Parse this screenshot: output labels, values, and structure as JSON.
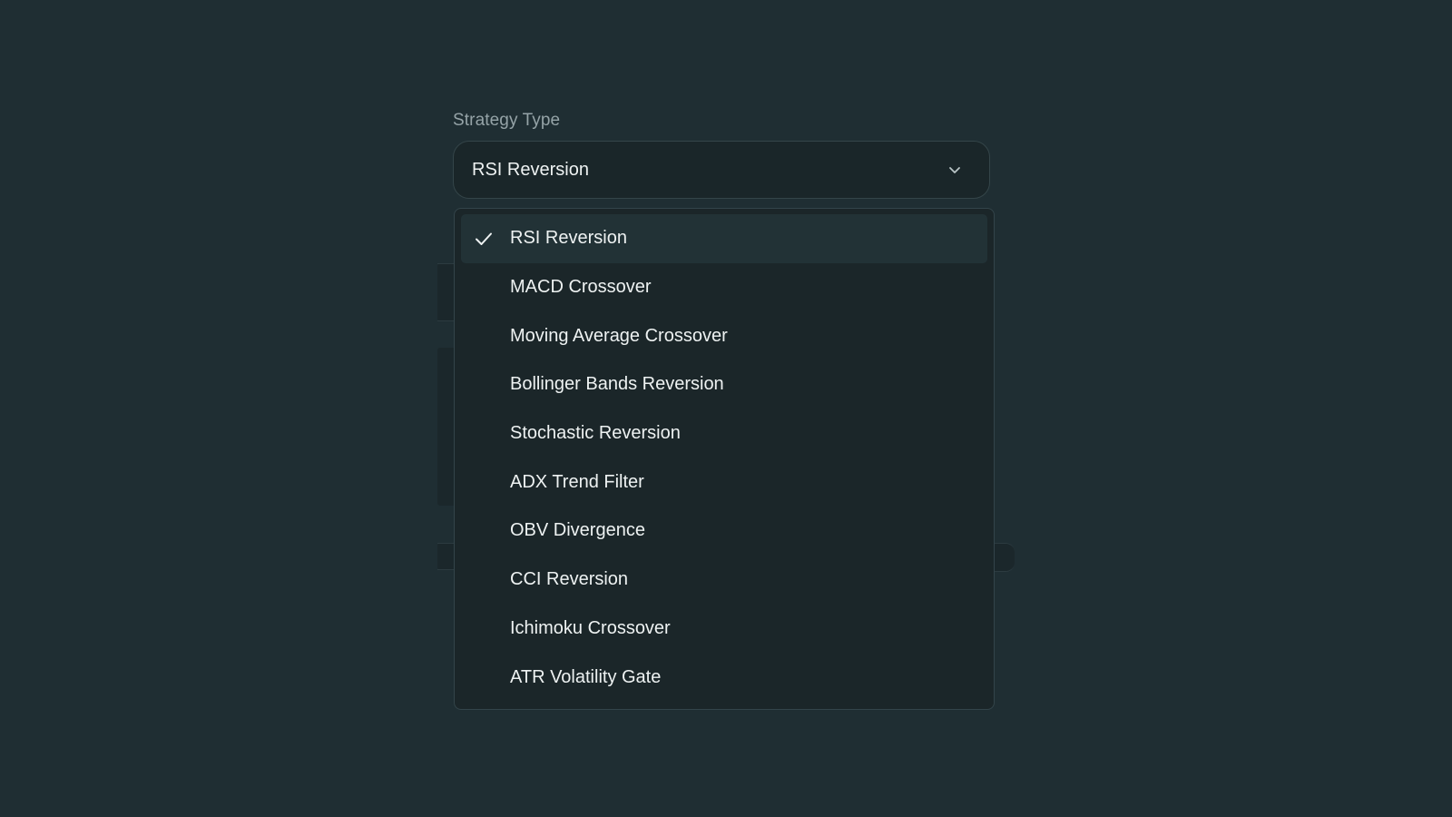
{
  "field": {
    "label": "Strategy Type",
    "selected_value": "RSI Reversion"
  },
  "dropdown": {
    "selected_index": 0,
    "options": [
      {
        "label": "RSI Reversion",
        "selected": true
      },
      {
        "label": "MACD Crossover",
        "selected": false
      },
      {
        "label": "Moving Average Crossover",
        "selected": false
      },
      {
        "label": "Bollinger Bands Reversion",
        "selected": false
      },
      {
        "label": "Stochastic Reversion",
        "selected": false
      },
      {
        "label": "ADX Trend Filter",
        "selected": false
      },
      {
        "label": "OBV Divergence",
        "selected": false
      },
      {
        "label": "CCI Reversion",
        "selected": false
      },
      {
        "label": "Ichimoku Crossover",
        "selected": false
      },
      {
        "label": "ATR Volatility Gate",
        "selected": false
      }
    ]
  },
  "icons": {
    "trigger": "chevron-down-icon",
    "selected_marker": "check-icon"
  },
  "colors": {
    "background": "#1f2e33",
    "surface": "#1b2629",
    "selected_row": "#223236",
    "text": "#eef2f2",
    "label_text": "#95a3a7",
    "border": "#344549"
  }
}
